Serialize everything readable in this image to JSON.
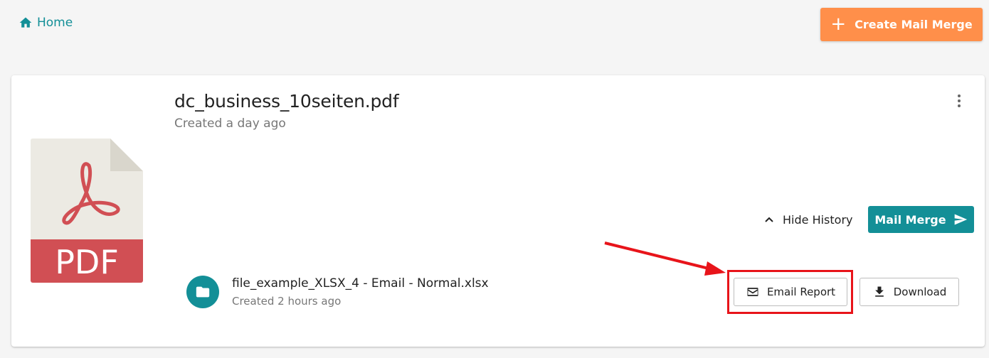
{
  "header": {
    "home_label": "Home",
    "create_button_label": "Create Mail Merge"
  },
  "document": {
    "title": "dc_business_10seiten.pdf",
    "subtitle": "Created a day ago",
    "icon_label": "PDF"
  },
  "actions": {
    "hide_history_label": "Hide History",
    "mail_merge_label": "Mail Merge"
  },
  "history": {
    "items": [
      {
        "file_name": "file_example_XLSX_4 - Email - Normal.xlsx",
        "created": "Created 2 hours ago",
        "email_report_label": "Email Report",
        "download_label": "Download"
      }
    ]
  },
  "colors": {
    "teal": "#138f97",
    "orange": "#ff8f4a",
    "pdf_red": "#d14f54",
    "annotation_red": "#e8141a"
  }
}
